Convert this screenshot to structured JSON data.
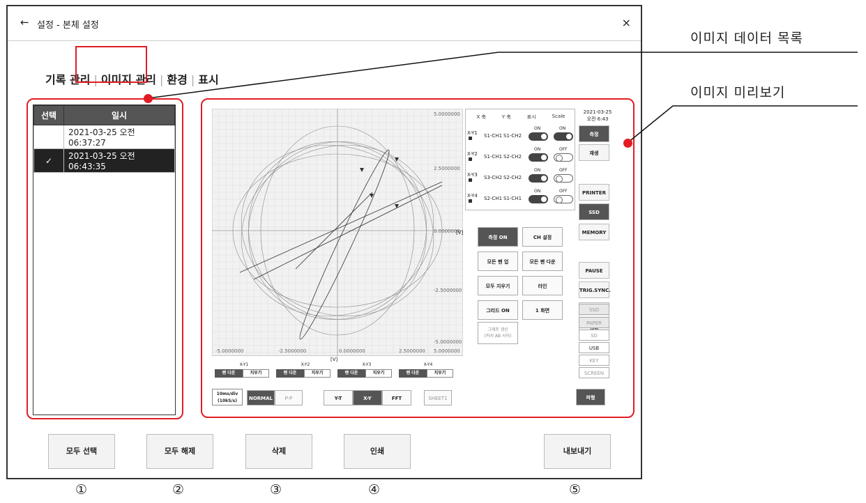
{
  "window": {
    "back_icon": "←",
    "title": "설정 - 본체 설정",
    "close_icon": "×"
  },
  "tabs": [
    {
      "label": "기록 관리"
    },
    {
      "label": "이미지 관리"
    },
    {
      "label": "환경"
    },
    {
      "label": "표시"
    }
  ],
  "list": {
    "headers": [
      "선택",
      "일시"
    ],
    "rows": [
      {
        "check": "",
        "datetime": "2021-03-25 오전 06:37:27"
      },
      {
        "check": "✓",
        "datetime": "2021-03-25 오전 06:43:35"
      }
    ]
  },
  "buttons": {
    "select_all": "모두 선택",
    "deselect_all": "모두 해제",
    "delete": "삭제",
    "print": "인쇄",
    "export": "내보내기"
  },
  "callouts": {
    "image_list": "이미지 데이터 목록",
    "image_preview": "이미지 미리보기"
  },
  "numbers": [
    "①",
    "②",
    "③",
    "④",
    "⑤"
  ],
  "preview": {
    "y_ticks": [
      "5.0000000",
      "2.5000000",
      "0.0000000",
      "-2.5000000",
      "-5.0000000"
    ],
    "x_ticks": [
      "-5.0000000",
      "-2.5000000",
      "0.0000000",
      "2.5000000",
      "5.0000000"
    ],
    "y_unit": "[V]",
    "x_unit": "[V]",
    "table_headers": [
      "X 축",
      "Y 축",
      "표시",
      "Scale"
    ],
    "xy_rows": [
      {
        "name": "X-Y1",
        "x": "S1-CH1",
        "y": "S1-CH2",
        "disp": "ON",
        "scale": "ON"
      },
      {
        "name": "X-Y2",
        "x": "S1-CH1",
        "y": "S2-CH2",
        "disp": "ON",
        "scale": "OFF"
      },
      {
        "name": "X-Y3",
        "x": "S3-CH2",
        "y": "S2-CH2",
        "disp": "ON",
        "scale": "OFF"
      },
      {
        "name": "X-Y4",
        "x": "S2-CH1",
        "y": "S1-CH1",
        "disp": "ON",
        "scale": "OFF"
      }
    ],
    "date": "2021-03-25",
    "time": "오전 6:43",
    "side_buttons": [
      "측정",
      "재생",
      "PRINTER",
      "SSD",
      "MEMORY",
      "PAUSE",
      "TRIG.SYNC.",
      "CH",
      "설정"
    ],
    "storage": [
      "SSD",
      "PAPER",
      "SD",
      "USB",
      "KEY",
      "SCREEN"
    ],
    "grid_buttons": [
      "측정 ON",
      "CH 설정",
      "모든 펜 업",
      "모든 펜 다운",
      "모두 지우기",
      "라인",
      "그리드 ON",
      "1 화면"
    ],
    "graph_update": [
      "그래프 갱신",
      "(커서 AB 사이)"
    ],
    "pen_labels": [
      "X-Y1",
      "X-Y2",
      "X-Y3",
      "X-Y4"
    ],
    "pen_down": "펜 다운",
    "erase": "지우기",
    "time_div": [
      "10ms/div",
      "(10kS/s)"
    ],
    "modes": [
      "NORMAL",
      "P-P"
    ],
    "views": [
      "Y-T",
      "X-Y",
      "FFT"
    ],
    "sheet": "SHEET1",
    "waveform": "파형"
  }
}
